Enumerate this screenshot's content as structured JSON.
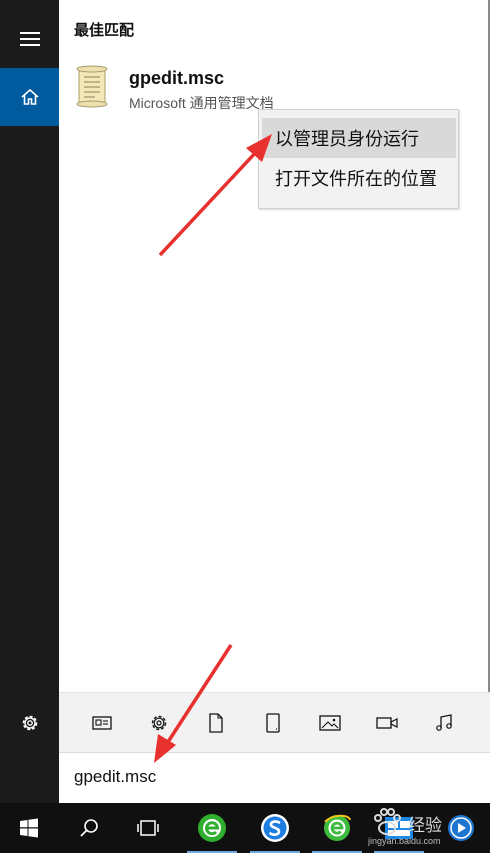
{
  "start_menu": {
    "section_title": "最佳匹配",
    "result": {
      "title": "gpedit.msc",
      "subtitle": "Microsoft 通用管理文档",
      "icon": "scroll-document-icon"
    }
  },
  "context_menu": {
    "items": [
      {
        "label": "以管理员身份运行",
        "state": "hover"
      },
      {
        "label": "打开文件所在的位置",
        "state": "normal"
      }
    ]
  },
  "rail": {
    "icons": [
      "hamburger-menu-icon",
      "home-icon",
      "settings-gear-icon"
    ],
    "accent": "#005a9e"
  },
  "filter_icons": [
    "app-icon",
    "settings-icon",
    "document-icon",
    "tablet-icon",
    "photo-icon",
    "video-icon",
    "music-icon"
  ],
  "search": {
    "value": "gpedit.msc"
  },
  "taskbar": {
    "icons": [
      "windows-start-icon",
      "search-icon",
      "task-view-icon",
      "ie-browser-icon",
      "sogou-browser-icon",
      "ie-browser-icon",
      "app-window-icon",
      "media-icon"
    ]
  },
  "watermark": {
    "text": "经验",
    "url": "jingyan.baidu.com"
  },
  "colors": {
    "annotation_arrow": "#e8312f"
  }
}
